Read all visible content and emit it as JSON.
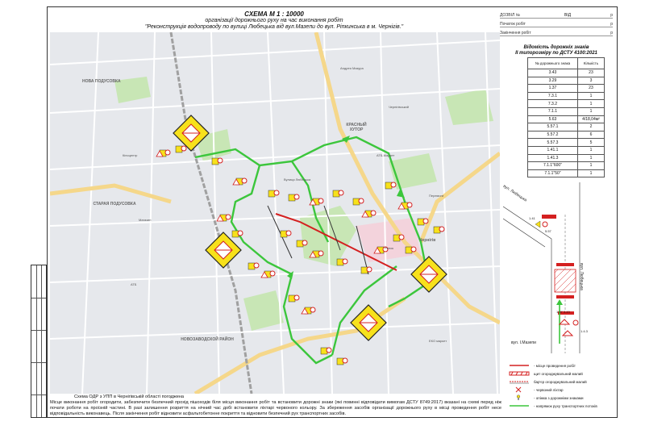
{
  "title": {
    "line1": "СХЕМА М 1 : 10000",
    "line2": "організації дорожнього руху на час виконання робіт",
    "line3": "\"Реконструкція водопроводу по вулиці Любецька від вул.Мазепи до вул. Ріпкинська в м. Чернігів.\""
  },
  "approval": {
    "rows": [
      {
        "label": "ДОЗВІЛ №",
        "mid": "ВІД",
        "end": "р"
      },
      {
        "label": "Початок робіт",
        "mid": "",
        "end": "р"
      },
      {
        "label": "Закінчення робіт",
        "mid": "",
        "end": "р"
      }
    ]
  },
  "signs_register": {
    "title1": "Відомість дорожніх знаків",
    "title2": "ІІ типорозміру по ДСТУ 4100:2021",
    "col1": "№ дорожнього знака",
    "col2": "Кількість",
    "rows": [
      {
        "sign": "3.43",
        "qty": "23"
      },
      {
        "sign": "3.29",
        "qty": "3"
      },
      {
        "sign": "1.37",
        "qty": "23"
      },
      {
        "sign": "7.3.1",
        "qty": "1"
      },
      {
        "sign": "7.3.2",
        "qty": "1"
      },
      {
        "sign": "7.1.1",
        "qty": "1"
      },
      {
        "sign": "5.63",
        "qty": "4/18,04м²"
      },
      {
        "sign": "5.57.1",
        "qty": "2"
      },
      {
        "sign": "5.57.2",
        "qty": "6"
      },
      {
        "sign": "5.57.3",
        "qty": "5"
      },
      {
        "sign": "1.41.1",
        "qty": "1"
      },
      {
        "sign": "1.41.3",
        "qty": "1"
      },
      {
        "sign": "7.1.1\"600\"",
        "qty": "1"
      },
      {
        "sign": "7.1.1\"50\"",
        "qty": "1"
      }
    ]
  },
  "inset": {
    "street1": "вул. Любецька",
    "street2": "вул. І.Мазепи",
    "street3": "вул. Любецька",
    "sign_a": "1.41",
    "sign_b": "5.57",
    "sign_c": "1.37 3.43",
    "sign_d": "1.4.3"
  },
  "map": {
    "districts": [
      {
        "name": "НОВА ПОДУСОВКА"
      },
      {
        "name": "СТАРАЯ ПОДУСОВКА"
      },
      {
        "name": "НОВОЗАВОДСКОЙ РАЙОН"
      },
      {
        "name": "КРАСНЫЙ ХУТОР"
      },
      {
        "name": "Чернігів"
      }
    ],
    "labels": [
      "Андрея Мазура",
      "АТБ-Маркет",
      "Магазин",
      "Вулиця Любецька",
      "Чернігівський",
      "Кіноцентр",
      "Ринок",
      "ЕКО маркет",
      "АТБ",
      "Перемоги"
    ]
  },
  "legend": {
    "items": [
      {
        "text": "- місце проведення робіт",
        "color": "#d42020"
      },
      {
        "text": "щит огороджувальний малий",
        "color": "#d42020"
      },
      {
        "text": "бар'єр огороджувальний малий",
        "color": "#d42020"
      },
      {
        "text": "- червоний ліхтар",
        "color": "#d42020"
      },
      {
        "text": "- опіжка з дорожніми знаками",
        "color": "#333333"
      },
      {
        "text": "- напрямок руху транспортних потоків",
        "color": "#3cc63c"
      }
    ]
  },
  "footer": {
    "note": "Схема ОДР з УПП в Чернігівській області погоджена",
    "text": "Місце виконання робіт огородити, забезпечити безпечний прохід пішоходів біля місця виконання робіт та встановити дорожні знаки (які повинні відповідати вимогам ДСТУ 8749:2017) вказані на схемі перед ніж почати роботи на проїзній частині. В разі залишення розриття на нічний час добі встановити ліхтарі червоного кольору. За збереження засобів організації дорожнього руху в місці проведення робіт несе відповідальність виконавець. Після закінчення робіт відновити асфальтобетонне покриття та відновити безпечний рух транспортних засобів."
  },
  "colors": {
    "route": "#3cc63c",
    "work": "#d42020",
    "road": "#ffffff",
    "highway": "#f5d78a",
    "park": "#c8e6b5",
    "block": "#dcdfe3",
    "sign_yellow": "#f7e11b"
  }
}
